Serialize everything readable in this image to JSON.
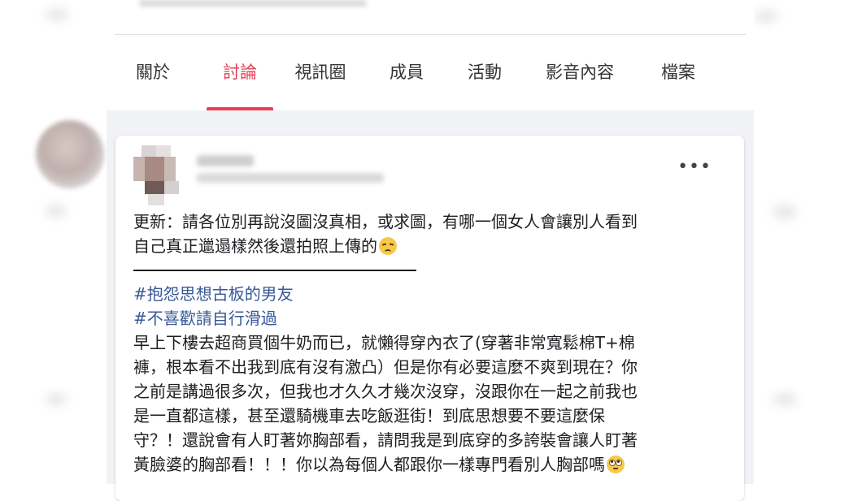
{
  "tabs": [
    {
      "label": "關於"
    },
    {
      "label": "討論",
      "active": true
    },
    {
      "label": "視訊圈"
    },
    {
      "label": "成員"
    },
    {
      "label": "活動"
    },
    {
      "label": "影音內容"
    },
    {
      "label": "檔案"
    }
  ],
  "colors": {
    "accent": "#e4405a",
    "hashtag": "#385898",
    "text": "#1c1e21",
    "feed_bg": "#f0f2f5"
  },
  "post": {
    "more_icon": "more-horizontal-icon",
    "update_line1": "更新：請各位別再說沒圖沒真相，或求圖，有哪一個女人會讓別人看到",
    "update_line2": "自己真正邋遢樣然後還拍照上傳的",
    "hashtags": [
      "#抱怨思想古板的男友",
      "#不喜歡請自行滑過"
    ],
    "body_lines": [
      "早上下樓去超商買個牛奶而已，就懶得穿內衣了(穿著非常寬鬆棉T+棉",
      "褲，根本看不出我到底有沒有激凸）但是你有必要這麼不爽到現在？你",
      "之前是講過很多次，但我也才久久才幾次沒穿，沒跟你在一起之前我也",
      "是一直都這樣，甚至還騎機車去吃飯逛街！到底思想要不要這麼保",
      "守？！還說會有人盯著妳胸部看，請問我是到底穿的多誇裝會讓人盯著",
      "黃臉婆的胸部看！！！你以為每個人都跟你一樣專門看別人胸部嗎"
    ]
  }
}
